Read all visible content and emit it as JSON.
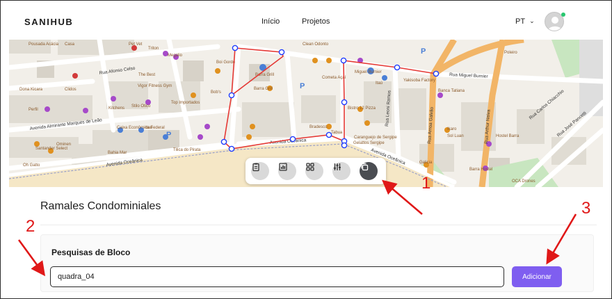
{
  "nav": {
    "brand": "SANIHUB",
    "links": [
      "Início",
      "Projetos"
    ],
    "language": "PT"
  },
  "map": {
    "street_labels": [
      "Rua Afonso Celso",
      "Avenida Almirante Marques de Leão",
      "Avenida Oceânica",
      "Avenida Oceânica",
      "Rua Miguel Burnier",
      "Rua Leoni Ramos",
      "Rua Arnoa Galvão",
      "Rua Arthur Neiva",
      "Rua Carlos Chiacchio",
      "Rua José Pancetti",
      "Avenida Oceânica"
    ],
    "poi_labels": [
      "Pousada Acácia",
      "Casa",
      "Pet Vet",
      "Triton",
      "Megalio",
      "Clean Odonto",
      "The Best",
      "Boi Gordo",
      "Barra Grill",
      "Dona Kicara",
      "Clidos",
      "Vigor Fitness Gym",
      "Barra Grill",
      "Bob's",
      "Top Importados",
      "Miguel Burnier",
      "Itaú",
      "Yakisoba Factory",
      "Banca Tatiana",
      "Perfil",
      "Kitchens",
      "Stilo Otico",
      "Cometa Açaí",
      "Bistro 12 Pizza",
      "Caixa Econômica Federal",
      "Itaú",
      "Bradesco",
      "Tabua",
      "Caranguejo de Sergipe",
      "Santander Select",
      "Ominen",
      "Bahia Mar",
      "Tilica do Pirata",
      "Galicia",
      "Ikaro",
      "Sol Luan",
      "Hostel Barra",
      "Barra Hostel",
      "Gelattos Sergipe",
      "Oh Gatto",
      "OCA Drones",
      "Poleiro"
    ],
    "toolbar": [
      {
        "icon": "clipboard-icon",
        "active": false
      },
      {
        "icon": "bar-chart-icon",
        "active": false
      },
      {
        "icon": "grid-icon",
        "active": false
      },
      {
        "icon": "sliders-icon",
        "active": false
      },
      {
        "icon": "copy-icon",
        "active": true
      }
    ]
  },
  "main": {
    "title": "Ramales Condominiales",
    "block": {
      "title": "Pesquisas de Bloco",
      "input_value": "quadra_04",
      "input_placeholder": "",
      "button_label": "Adicionar"
    }
  },
  "annotations": [
    "1",
    "2",
    "3"
  ],
  "colors": {
    "accent": "#7f5ef0",
    "polygon": "#e53935",
    "vertex": "#1e3cff",
    "annotation": "#e01818",
    "online": "#28c76f"
  }
}
